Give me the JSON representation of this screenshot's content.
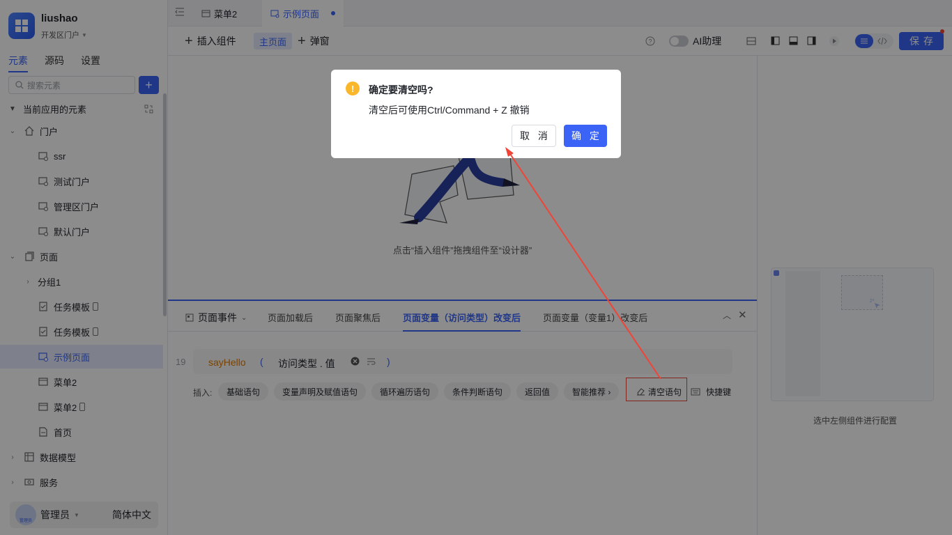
{
  "app": {
    "name": "liushao",
    "portal": "开发区门户"
  },
  "sidebar": {
    "tabs": [
      {
        "label": "元素"
      },
      {
        "label": "源码"
      },
      {
        "label": "设置"
      }
    ],
    "search_placeholder": "搜索元素",
    "section_title": "当前应用的元素",
    "items": [
      {
        "label": "门户"
      },
      {
        "label": "ssr"
      },
      {
        "label": "测试门户"
      },
      {
        "label": "管理区门户"
      },
      {
        "label": "默认门户"
      },
      {
        "label": "页面"
      },
      {
        "label": "分组1"
      },
      {
        "label": "任务模板"
      },
      {
        "label": "任务模板"
      },
      {
        "label": "示例页面"
      },
      {
        "label": "菜单2"
      },
      {
        "label": "菜单2"
      },
      {
        "label": "首页"
      },
      {
        "label": "数据模型"
      },
      {
        "label": "服务"
      }
    ],
    "user": {
      "name": "管理员",
      "avatar_text": "管理员"
    },
    "language": "简体中文"
  },
  "tabbar": {
    "tabs": [
      {
        "label": "菜单2"
      },
      {
        "label": "示例页面"
      }
    ]
  },
  "toolbar": {
    "insert_component": "插入组件",
    "main_page": "主页面",
    "popup": "弹窗",
    "ai_assistant": "AI助理",
    "save": "保存"
  },
  "canvas": {
    "empty_text": "点击“插入组件”拖拽组件至“设计器”"
  },
  "right_panel": {
    "hint": "选中左侧组件进行配置"
  },
  "events": {
    "selector": "页面事件",
    "tabs": [
      {
        "label": "页面加载后"
      },
      {
        "label": "页面聚焦后"
      },
      {
        "label": "页面变量（访问类型）改变后"
      },
      {
        "label": "页面变量（变量1）改变后"
      }
    ],
    "code": {
      "line_number": "19",
      "function": "sayHello",
      "open_paren": "(",
      "arg": "访问类型 . 值",
      "close_paren": ")"
    },
    "insert_label": "插入:",
    "chips": [
      {
        "label": "基础语句"
      },
      {
        "label": "变量声明及赋值语句"
      },
      {
        "label": "循环遍历语句"
      },
      {
        "label": "条件判断语句"
      },
      {
        "label": "返回值"
      },
      {
        "label": "智能推荐 ›"
      }
    ],
    "clear_statement": "清空语句",
    "shortcut": "快捷键"
  },
  "modal": {
    "title": "确定要清空吗?",
    "body": "清空后可使用Ctrl/Command + Z 撤销",
    "cancel": "取 消",
    "ok": "确 定"
  },
  "colors": {
    "accent": "#3b63f6",
    "warning": "#fbb72c",
    "annotation": "#f04438",
    "overlay": "rgba(0,0,0,0.45)"
  }
}
